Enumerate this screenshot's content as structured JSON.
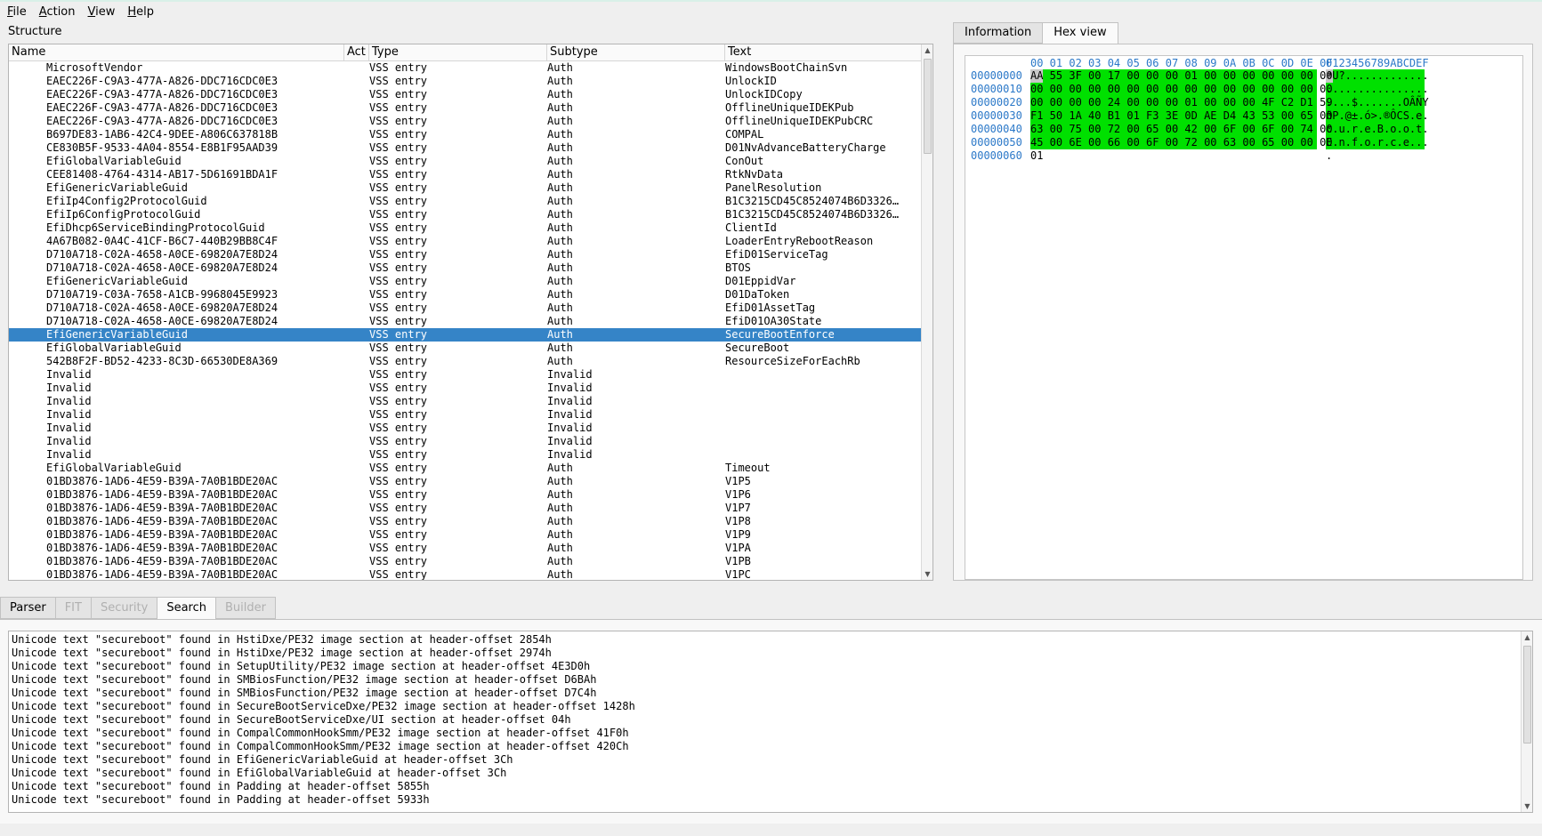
{
  "menu": [
    {
      "label": "File",
      "mnemonic": "F",
      "rest": "ile"
    },
    {
      "label": "Action",
      "mnemonic": "A",
      "rest": "ction"
    },
    {
      "label": "View",
      "mnemonic": "V",
      "rest": "iew"
    },
    {
      "label": "Help",
      "mnemonic": "H",
      "rest": "elp"
    }
  ],
  "structure": {
    "title": "Structure",
    "columns": [
      "Name",
      "Act",
      "Type",
      "Subtype",
      "Text"
    ],
    "selected_index": 20,
    "rows": [
      {
        "name": "MicrosoftVendor",
        "type": "VSS entry",
        "subtype": "Auth",
        "text": "WindowsBootChainSvn"
      },
      {
        "name": "EAEC226F-C9A3-477A-A826-DDC716CDC0E3",
        "type": "VSS entry",
        "subtype": "Auth",
        "text": "UnlockID"
      },
      {
        "name": "EAEC226F-C9A3-477A-A826-DDC716CDC0E3",
        "type": "VSS entry",
        "subtype": "Auth",
        "text": "UnlockIDCopy"
      },
      {
        "name": "EAEC226F-C9A3-477A-A826-DDC716CDC0E3",
        "type": "VSS entry",
        "subtype": "Auth",
        "text": "OfflineUniqueIDEKPub"
      },
      {
        "name": "EAEC226F-C9A3-477A-A826-DDC716CDC0E3",
        "type": "VSS entry",
        "subtype": "Auth",
        "text": "OfflineUniqueIDEKPubCRC"
      },
      {
        "name": "B697DE83-1AB6-42C4-9DEE-A806C637818B",
        "type": "VSS entry",
        "subtype": "Auth",
        "text": "COMPAL"
      },
      {
        "name": "CE830B5F-9533-4A04-8554-E8B1F95AAD39",
        "type": "VSS entry",
        "subtype": "Auth",
        "text": "D01NvAdvanceBatteryCharge"
      },
      {
        "name": "EfiGlobalVariableGuid",
        "type": "VSS entry",
        "subtype": "Auth",
        "text": "ConOut"
      },
      {
        "name": "CEE81408-4764-4314-AB17-5D61691BDA1F",
        "type": "VSS entry",
        "subtype": "Auth",
        "text": "RtkNvData"
      },
      {
        "name": "EfiGenericVariableGuid",
        "type": "VSS entry",
        "subtype": "Auth",
        "text": "PanelResolution"
      },
      {
        "name": "EfiIp4Config2ProtocolGuid",
        "type": "VSS entry",
        "subtype": "Auth",
        "text": "B1C3215CD45C8524074B6D3326…"
      },
      {
        "name": "EfiIp6ConfigProtocolGuid",
        "type": "VSS entry",
        "subtype": "Auth",
        "text": "B1C3215CD45C8524074B6D3326…"
      },
      {
        "name": "EfiDhcp6ServiceBindingProtocolGuid",
        "type": "VSS entry",
        "subtype": "Auth",
        "text": "ClientId"
      },
      {
        "name": "4A67B082-0A4C-41CF-B6C7-440B29BB8C4F",
        "type": "VSS entry",
        "subtype": "Auth",
        "text": "LoaderEntryRebootReason"
      },
      {
        "name": "D710A718-C02A-4658-A0CE-69820A7E8D24",
        "type": "VSS entry",
        "subtype": "Auth",
        "text": "EfiD01ServiceTag"
      },
      {
        "name": "D710A718-C02A-4658-A0CE-69820A7E8D24",
        "type": "VSS entry",
        "subtype": "Auth",
        "text": "BTOS"
      },
      {
        "name": "EfiGenericVariableGuid",
        "type": "VSS entry",
        "subtype": "Auth",
        "text": "D01EppidVar"
      },
      {
        "name": "D710A719-C03A-7658-A1CB-9968045E9923",
        "type": "VSS entry",
        "subtype": "Auth",
        "text": "D01DaToken"
      },
      {
        "name": "D710A718-C02A-4658-A0CE-69820A7E8D24",
        "type": "VSS entry",
        "subtype": "Auth",
        "text": "EfiD01AssetTag"
      },
      {
        "name": "D710A718-C02A-4658-A0CE-69820A7E8D24",
        "type": "VSS entry",
        "subtype": "Auth",
        "text": "EfiD01OA30State"
      },
      {
        "name": "EfiGenericVariableGuid",
        "type": "VSS entry",
        "subtype": "Auth",
        "text": "SecureBootEnforce"
      },
      {
        "name": "EfiGlobalVariableGuid",
        "type": "VSS entry",
        "subtype": "Auth",
        "text": "SecureBoot"
      },
      {
        "name": "542B8F2F-BD52-4233-8C3D-66530DE8A369",
        "type": "VSS entry",
        "subtype": "Auth",
        "text": "ResourceSizeForEachRb"
      },
      {
        "name": "Invalid",
        "type": "VSS entry",
        "subtype": "Invalid",
        "text": ""
      },
      {
        "name": "Invalid",
        "type": "VSS entry",
        "subtype": "Invalid",
        "text": ""
      },
      {
        "name": "Invalid",
        "type": "VSS entry",
        "subtype": "Invalid",
        "text": ""
      },
      {
        "name": "Invalid",
        "type": "VSS entry",
        "subtype": "Invalid",
        "text": ""
      },
      {
        "name": "Invalid",
        "type": "VSS entry",
        "subtype": "Invalid",
        "text": ""
      },
      {
        "name": "Invalid",
        "type": "VSS entry",
        "subtype": "Invalid",
        "text": ""
      },
      {
        "name": "Invalid",
        "type": "VSS entry",
        "subtype": "Invalid",
        "text": ""
      },
      {
        "name": "EfiGlobalVariableGuid",
        "type": "VSS entry",
        "subtype": "Auth",
        "text": "Timeout"
      },
      {
        "name": "01BD3876-1AD6-4E59-B39A-7A0B1BDE20AC",
        "type": "VSS entry",
        "subtype": "Auth",
        "text": "V1P5"
      },
      {
        "name": "01BD3876-1AD6-4E59-B39A-7A0B1BDE20AC",
        "type": "VSS entry",
        "subtype": "Auth",
        "text": "V1P6"
      },
      {
        "name": "01BD3876-1AD6-4E59-B39A-7A0B1BDE20AC",
        "type": "VSS entry",
        "subtype": "Auth",
        "text": "V1P7"
      },
      {
        "name": "01BD3876-1AD6-4E59-B39A-7A0B1BDE20AC",
        "type": "VSS entry",
        "subtype": "Auth",
        "text": "V1P8"
      },
      {
        "name": "01BD3876-1AD6-4E59-B39A-7A0B1BDE20AC",
        "type": "VSS entry",
        "subtype": "Auth",
        "text": "V1P9"
      },
      {
        "name": "01BD3876-1AD6-4E59-B39A-7A0B1BDE20AC",
        "type": "VSS entry",
        "subtype": "Auth",
        "text": "V1PA"
      },
      {
        "name": "01BD3876-1AD6-4E59-B39A-7A0B1BDE20AC",
        "type": "VSS entry",
        "subtype": "Auth",
        "text": "V1PB"
      },
      {
        "name": "01BD3876-1AD6-4E59-B39A-7A0B1BDE20AC",
        "type": "VSS entry",
        "subtype": "Auth",
        "text": "V1PC"
      }
    ]
  },
  "right_tabs": [
    {
      "label": "Information",
      "active": false
    },
    {
      "label": "Hex view",
      "active": true
    }
  ],
  "hex": {
    "header_bytes": "00 01 02 03 04 05 06 07 08 09 0A 0B 0C 0D 0E 0F",
    "header_ascii": "0123456789ABCDEF",
    "rows": [
      {
        "offset": "00000000",
        "bytes": "AA 55 3F 00 17 00 00 00 01 00 00 00 00 00 00 00",
        "ascii": "ªU?.............",
        "highlight": true
      },
      {
        "offset": "00000010",
        "bytes": "00 00 00 00 00 00 00 00 00 00 00 00 00 00 00 00",
        "ascii": "................",
        "highlight": true
      },
      {
        "offset": "00000020",
        "bytes": "00 00 00 00 24 00 00 00 01 00 00 00 4F C2 D1 59",
        "ascii": "....$.......OÂÑY",
        "highlight": true
      },
      {
        "offset": "00000030",
        "bytes": "F1 50 1A 40 B1 01 F3 3E 0D AE D4 43 53 00 65 00",
        "ascii": "ñP.@±.ó>.®ÔCS.e.",
        "highlight": true
      },
      {
        "offset": "00000040",
        "bytes": "63 00 75 00 72 00 65 00 42 00 6F 00 6F 00 74 00",
        "ascii": "c.u.r.e.B.o.o.t.",
        "highlight": true
      },
      {
        "offset": "00000050",
        "bytes": "45 00 6E 00 66 00 6F 00 72 00 63 00 65 00 00 00",
        "ascii": "E.n.f.o.r.c.e...",
        "highlight": true
      },
      {
        "offset": "00000060",
        "bytes": "01",
        "ascii": ".",
        "highlight": false
      }
    ]
  },
  "bottom_tabs": [
    {
      "label": "Parser",
      "enabled": true,
      "active": false
    },
    {
      "label": "FIT",
      "enabled": false,
      "active": false
    },
    {
      "label": "Security",
      "enabled": false,
      "active": false
    },
    {
      "label": "Search",
      "enabled": true,
      "active": true
    },
    {
      "label": "Builder",
      "enabled": false,
      "active": false
    }
  ],
  "messages": [
    "Unicode text \"secureboot\" found in HstiDxe/PE32 image section at header-offset 2854h",
    "Unicode text \"secureboot\" found in HstiDxe/PE32 image section at header-offset 2974h",
    "Unicode text \"secureboot\" found in SetupUtility/PE32 image section at header-offset 4E3D0h",
    "Unicode text \"secureboot\" found in SMBiosFunction/PE32 image section at header-offset D6BAh",
    "Unicode text \"secureboot\" found in SMBiosFunction/PE32 image section at header-offset D7C4h",
    "Unicode text \"secureboot\" found in SecureBootServiceDxe/PE32 image section at header-offset 1428h",
    "Unicode text \"secureboot\" found in SecureBootServiceDxe/UI section at header-offset 04h",
    "Unicode text \"secureboot\" found in CompalCommonHookSmm/PE32 image section at header-offset 41F0h",
    "Unicode text \"secureboot\" found in CompalCommonHookSmm/PE32 image section at header-offset 420Ch",
    "Unicode text \"secureboot\" found in EfiGenericVariableGuid at header-offset 3Ch",
    "Unicode text \"secureboot\" found in EfiGlobalVariableGuid at header-offset 3Ch",
    "Unicode text \"secureboot\" found in Padding at header-offset 5855h",
    "Unicode text \"secureboot\" found in Padding at header-offset 5933h"
  ],
  "colors": {
    "selection": "#3584c7",
    "hex_highlight": "#00e000",
    "hex_offset": "#2b78c8"
  }
}
